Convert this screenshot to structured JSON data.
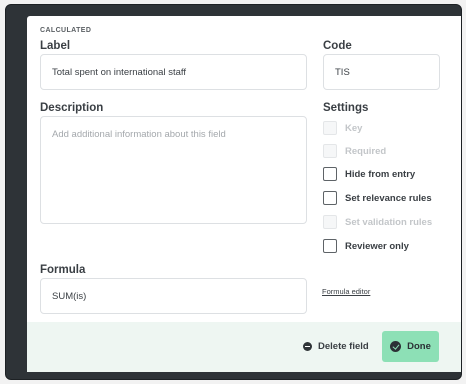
{
  "dialog": {
    "type_tag": "CALCULATED",
    "label": {
      "title": "Label",
      "value": "Total spent on international staff"
    },
    "code": {
      "title": "Code",
      "value": "TIS"
    },
    "description": {
      "title": "Description",
      "placeholder": "Add additional information about this field"
    },
    "settings": {
      "title": "Settings",
      "options": [
        {
          "label": "Key",
          "checked": false,
          "disabled": true
        },
        {
          "label": "Required",
          "checked": false,
          "disabled": true
        },
        {
          "label": "Hide from entry",
          "checked": false,
          "disabled": false
        },
        {
          "label": "Set relevance rules",
          "checked": false,
          "disabled": false
        },
        {
          "label": "Set validation rules",
          "checked": false,
          "disabled": true
        },
        {
          "label": "Reviewer only",
          "checked": false,
          "disabled": false
        }
      ]
    },
    "formula": {
      "title": "Formula",
      "value": "SUM(is)"
    },
    "formula_editor_link": "Formula editor"
  },
  "footer": {
    "delete_label": "Delete field",
    "done_label": "Done"
  },
  "colors": {
    "frame": "#2e3337",
    "footer_bg": "#eef6f2",
    "done_button": "#8de0b6"
  }
}
